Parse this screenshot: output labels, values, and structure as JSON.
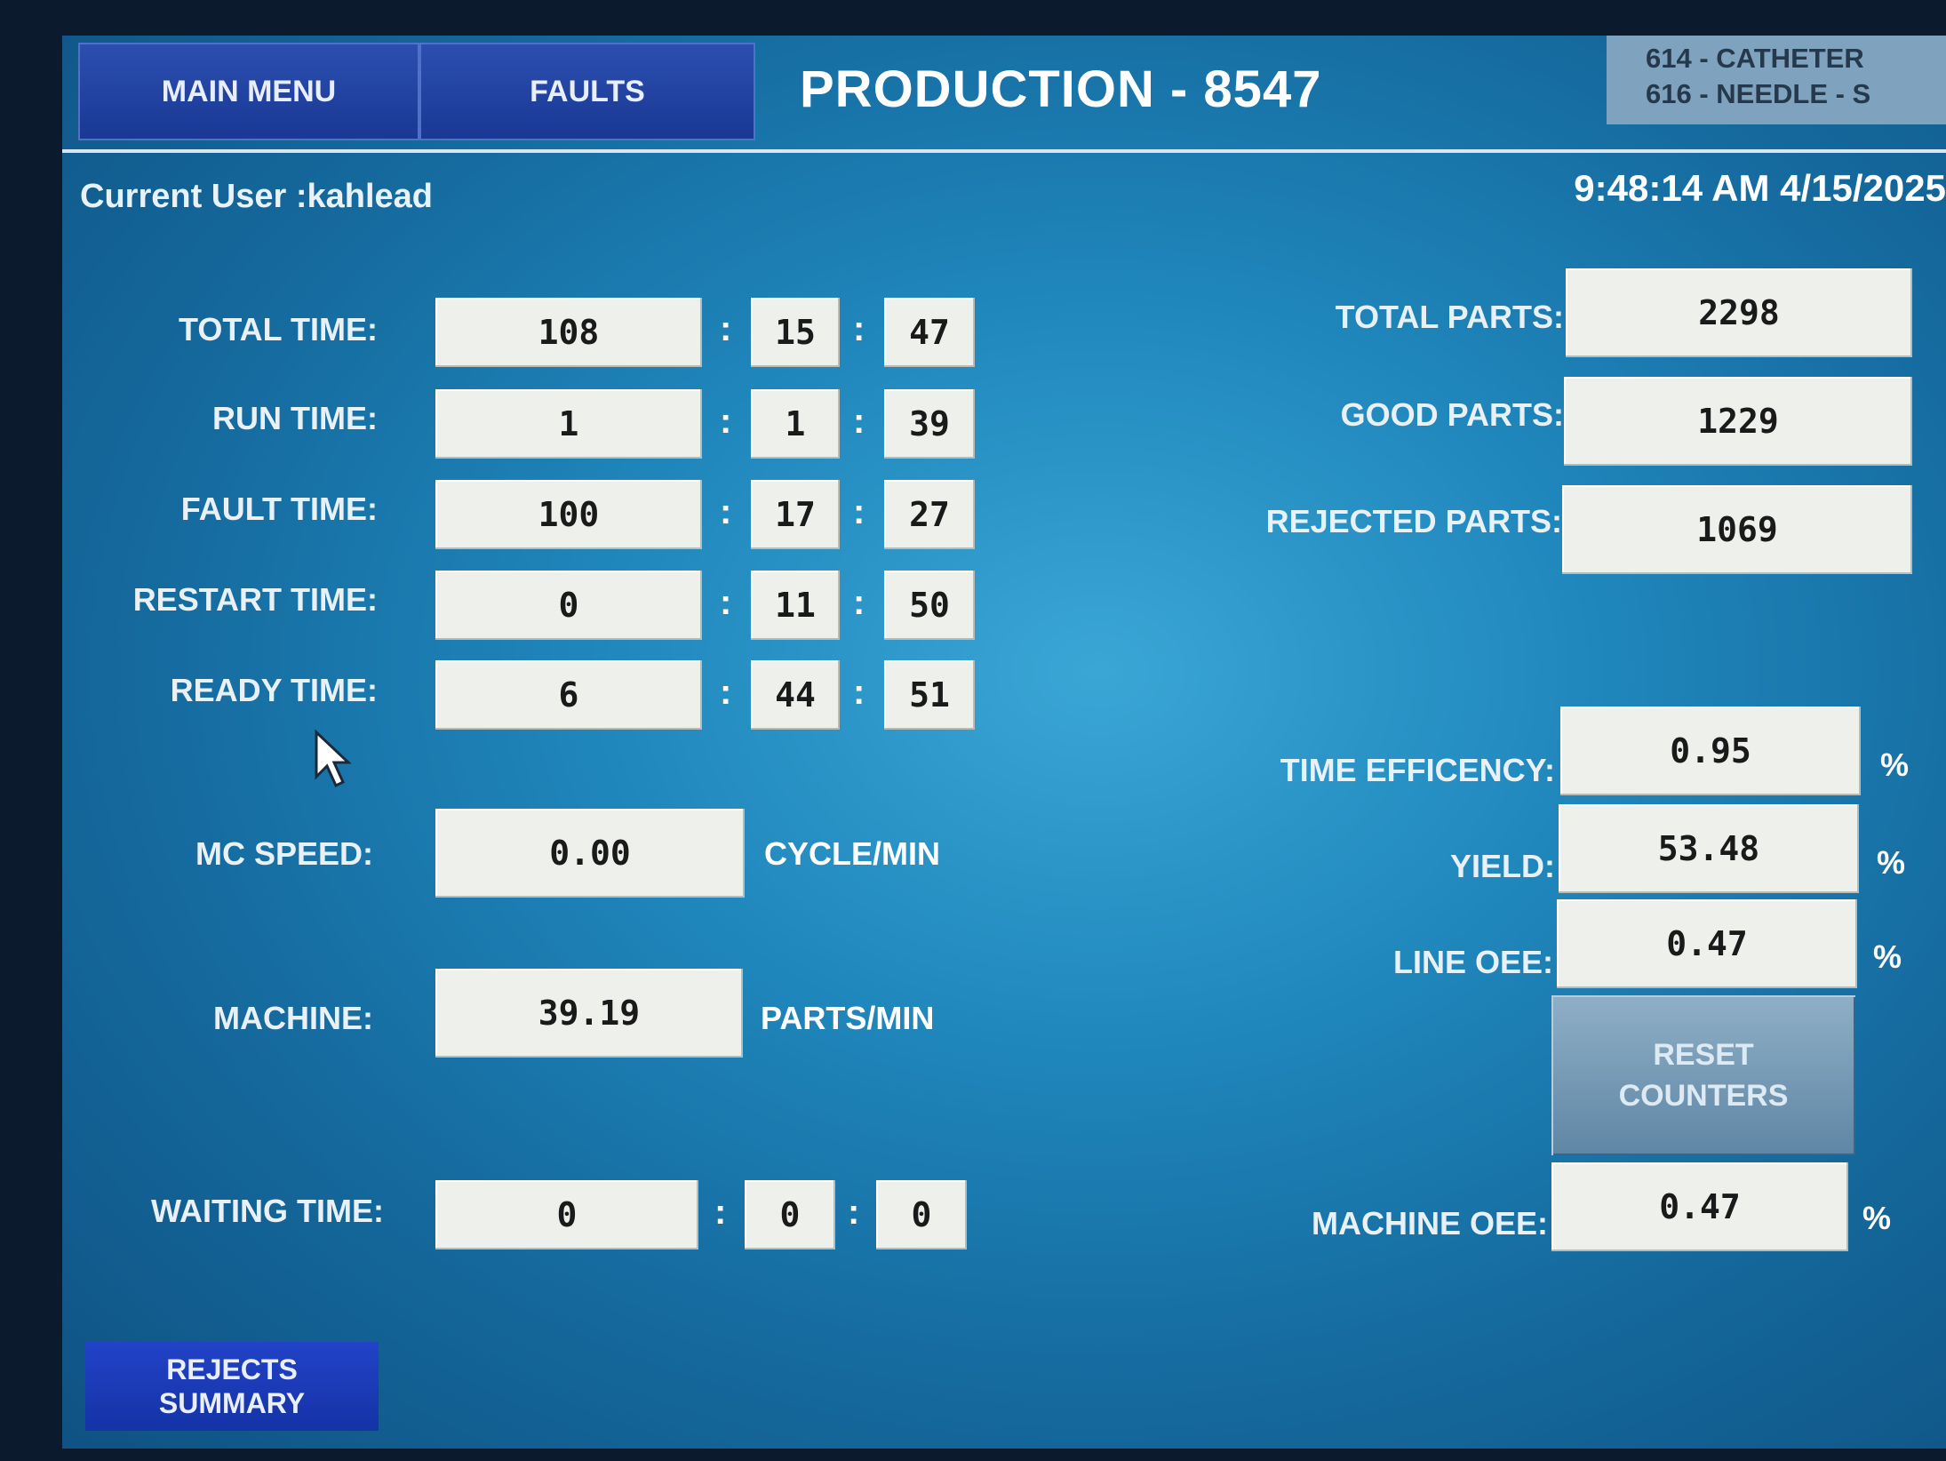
{
  "header": {
    "main_menu_label": "MAIN MENU",
    "faults_label": "FAULTS",
    "title": "PRODUCTION - 8547",
    "recipe_line1": "614 - CATHETER",
    "recipe_line2": "616 - NEEDLE - S"
  },
  "status": {
    "current_user": "Current User :kahlead",
    "datetime": "9:48:14 AM 4/15/2025"
  },
  "times": [
    {
      "label": "TOTAL TIME:",
      "h": "108",
      "m": "15",
      "s": "47"
    },
    {
      "label": "RUN TIME:",
      "h": "1",
      "m": "1",
      "s": "39"
    },
    {
      "label": "FAULT TIME:",
      "h": "100",
      "m": "17",
      "s": "27"
    },
    {
      "label": "RESTART TIME:",
      "h": "0",
      "m": "11",
      "s": "50"
    },
    {
      "label": "READY TIME:",
      "h": "6",
      "m": "44",
      "s": "51"
    }
  ],
  "colon": ":",
  "mc_speed": {
    "label": "MC SPEED:",
    "value": "0.00",
    "unit": "CYCLE/MIN"
  },
  "machine": {
    "label": "MACHINE:",
    "value": "39.19",
    "unit": "PARTS/MIN"
  },
  "waiting": {
    "label": "WAITING TIME:",
    "h": "0",
    "m": "0",
    "s": "0"
  },
  "parts": {
    "total_label": "TOTAL PARTS:",
    "total": "2298",
    "good_label": "GOOD PARTS:",
    "good": "1229",
    "rejected_label": "REJECTED PARTS:",
    "rejected": "1069"
  },
  "metrics": {
    "time_eff_label": "TIME EFFICENCY:",
    "time_eff": "0.95",
    "yield_label": "YIELD:",
    "yield": "53.48",
    "line_oee_label": "LINE OEE:",
    "line_oee": "0.47",
    "machine_oee_label": "MACHINE OEE:",
    "machine_oee": "0.47",
    "pct": "%"
  },
  "buttons": {
    "reset_line1": "RESET",
    "reset_line2": "COUNTERS",
    "rejects_line1": "REJECTS",
    "rejects_line2": "SUMMARY"
  }
}
